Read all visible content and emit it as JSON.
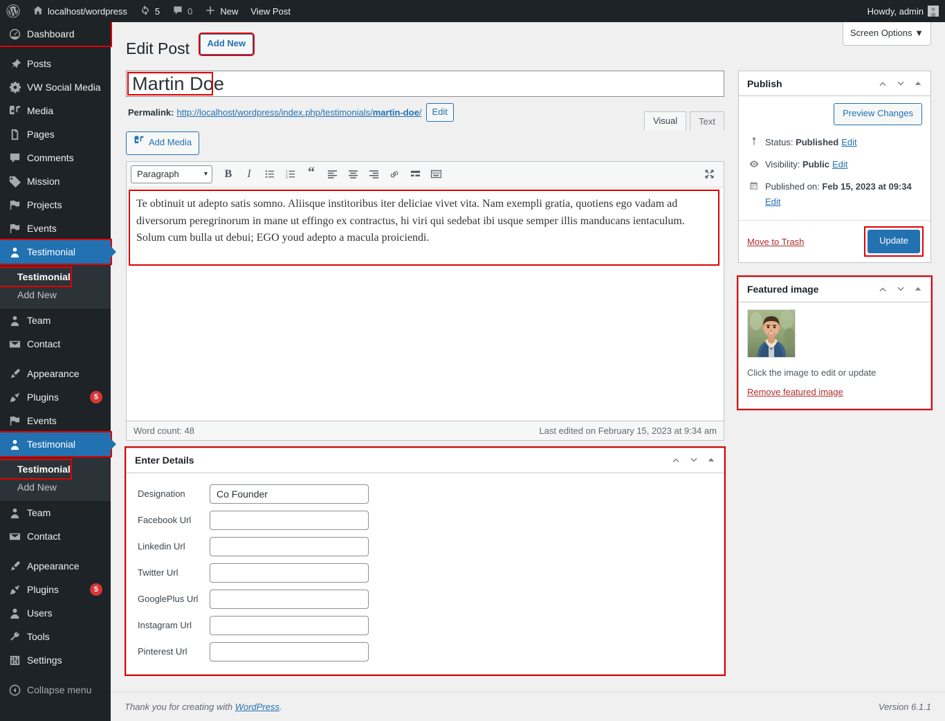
{
  "adminbar": {
    "logo_icon": "wordpress-logo-icon",
    "site_icon": "home-icon",
    "site_name": "localhost/wordpress",
    "updates_icon": "updates-icon",
    "updates_count": "5",
    "comments_icon": "comment-bubble-icon",
    "comments_count": "0",
    "new_icon": "plus-icon",
    "new_label": "New",
    "view_post_label": "View Post",
    "howdy": "Howdy, admin",
    "avatar_icon": "avatar-icon"
  },
  "sidebar": {
    "items": [
      {
        "label": "Dashboard",
        "icon": "dashboard-icon",
        "current": false,
        "highlight": true
      },
      {
        "label": "Posts",
        "icon": "pin-icon"
      },
      {
        "label": "VW Social Media",
        "icon": "gear-icon"
      },
      {
        "label": "Media",
        "icon": "media-icon"
      },
      {
        "label": "Pages",
        "icon": "pages-icon"
      },
      {
        "label": "Comments",
        "icon": "comment-bubble-icon"
      },
      {
        "label": "Mission",
        "icon": "tag-icon"
      },
      {
        "label": "Projects",
        "icon": "flag-icon"
      },
      {
        "label": "Events",
        "icon": "flag-icon"
      },
      {
        "label": "Testimonial",
        "icon": "user-icon",
        "current": true,
        "highlight": true
      },
      {
        "label": "Team",
        "icon": "user-icon"
      },
      {
        "label": "Contact",
        "icon": "envelope-icon"
      },
      {
        "label": "Appearance",
        "icon": "brush-icon"
      },
      {
        "label": "Plugins",
        "icon": "plug-icon",
        "badge": "5"
      },
      {
        "label": "Events",
        "icon": "flag-icon"
      },
      {
        "label": "Testimonial",
        "icon": "user-icon",
        "current": true,
        "highlight": true
      },
      {
        "label": "Team",
        "icon": "user-icon"
      },
      {
        "label": "Contact",
        "icon": "envelope-icon"
      },
      {
        "label": "Appearance",
        "icon": "brush-icon"
      },
      {
        "label": "Plugins",
        "icon": "plug-icon",
        "badge": "5"
      },
      {
        "label": "Users",
        "icon": "users-icon"
      },
      {
        "label": "Tools",
        "icon": "wrench-icon"
      },
      {
        "label": "Settings",
        "icon": "settings-sliders-icon"
      },
      {
        "label": "Collapse menu",
        "icon": "collapse-arrow-icon"
      }
    ],
    "submenu": {
      "current_label": "Testimonial",
      "add_new_label": "Add New"
    }
  },
  "screen_options": {
    "label": "Screen Options",
    "chevron": "▼"
  },
  "page": {
    "title": "Edit Post",
    "add_new_label": "Add New"
  },
  "post": {
    "title_value": "Martin Doe",
    "title_placeholder": "Add title",
    "permalink_label": "Permalink:",
    "permalink_prefix": "http://localhost/wordpress/index.php/testimonials/",
    "permalink_slug": "martin-doe",
    "permalink_suffix": "/",
    "permalink_edit_label": "Edit",
    "add_media_label": "Add Media",
    "add_media_icon": "media-icon",
    "tab_visual": "Visual",
    "tab_text": "Text",
    "content": "Te obtinuit ut adepto satis somno. Aliisque institoribus iter deliciae vivet vita. Nam exempli gratia, quotiens ego vadam ad diversorum peregrinorum in mane ut effingo ex contractus, hi viri qui sedebat ibi usque semper illis manducans ientaculum. Solum cum bulla ut debui; EGO youd adepto a macula proiciendi.",
    "word_count": "Word count: 48",
    "last_edited": "Last edited on February 15, 2023 at 9:34 am"
  },
  "toolbar": {
    "format_select": "Paragraph",
    "format_chevron": "▾",
    "buttons": [
      {
        "name": "bold-icon",
        "label": "B"
      },
      {
        "name": "italic-icon",
        "label": "I"
      },
      {
        "name": "bulleted-list-icon",
        "label": ""
      },
      {
        "name": "numbered-list-icon",
        "label": ""
      },
      {
        "name": "blockquote-icon",
        "label": "“"
      },
      {
        "name": "align-left-icon",
        "label": ""
      },
      {
        "name": "align-center-icon",
        "label": ""
      },
      {
        "name": "align-right-icon",
        "label": ""
      },
      {
        "name": "link-icon",
        "label": ""
      },
      {
        "name": "read-more-icon",
        "label": ""
      },
      {
        "name": "toolbar-toggle-icon",
        "label": ""
      }
    ],
    "fullscreen_icon": "fullscreen-icon"
  },
  "publish": {
    "heading": "Publish",
    "preview_label": "Preview Changes",
    "status_icon": "pin-flag-icon",
    "status_label": "Status:",
    "status_value": "Published",
    "status_edit": "Edit",
    "visibility_icon": "eye-icon",
    "visibility_label": "Visibility:",
    "visibility_value": "Public",
    "visibility_edit": "Edit",
    "date_icon": "calendar-icon",
    "date_label": "Published on:",
    "date_value": "Feb 15, 2023 at 09:34",
    "date_edit": "Edit",
    "trash_label": "Move to Trash",
    "update_label": "Update"
  },
  "featured_image": {
    "heading": "Featured image",
    "hint": "Click the image to edit or update",
    "remove_label": "Remove featured image",
    "image_alt": "smiling-man-denim-jacket-photo"
  },
  "details": {
    "heading": "Enter Details",
    "fields": [
      {
        "label": "Designation",
        "value": "Co Founder"
      },
      {
        "label": "Facebook Url",
        "value": ""
      },
      {
        "label": "Linkedin Url",
        "value": ""
      },
      {
        "label": "Twitter Url",
        "value": ""
      },
      {
        "label": "GooglePlus Url",
        "value": ""
      },
      {
        "label": "Instagram Url",
        "value": ""
      },
      {
        "label": "Pinterest Url",
        "value": ""
      }
    ]
  },
  "footer": {
    "thanks_prefix": "Thank you for creating with ",
    "wordpress_link": "WordPress",
    "thanks_suffix": ".",
    "version": "Version 6.1.1"
  },
  "colors": {
    "accent": "#2271b1",
    "admin_bg": "#1d2327",
    "submenu_bg": "#2c3338",
    "danger": "#b32d2e",
    "badge": "#d63638",
    "highlight_outline": "#e20000"
  }
}
